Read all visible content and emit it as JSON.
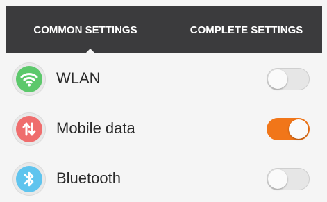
{
  "tabs": {
    "common_label": "COMMON SETTINGS",
    "complete_label": "COMPLETE SETTINGS",
    "active": "common"
  },
  "settings": [
    {
      "label": "WLAN",
      "icon": "wifi-icon",
      "icon_color": "#5cc86b",
      "enabled": false
    },
    {
      "label": "Mobile data",
      "icon": "mobile-data-icon",
      "icon_color": "#ef6d6d",
      "enabled": true
    },
    {
      "label": "Bluetooth",
      "icon": "bluetooth-icon",
      "icon_color": "#5fc4ee",
      "enabled": false
    }
  ],
  "colors": {
    "tabbar_bg": "#3b3b3d",
    "toggle_on": "#f17619",
    "toggle_off": "#e6e6e6"
  }
}
